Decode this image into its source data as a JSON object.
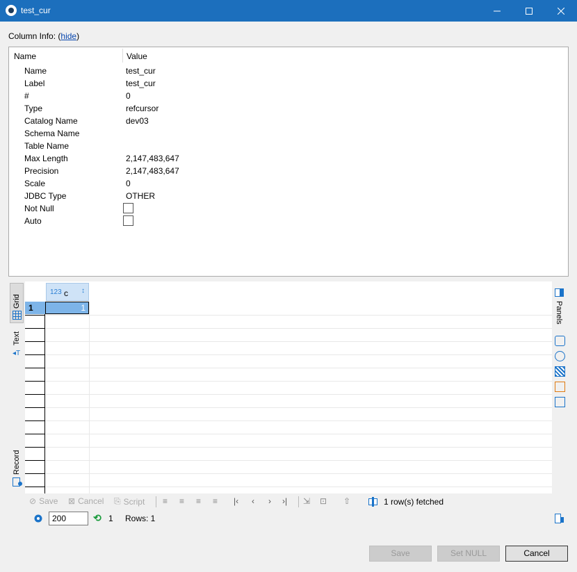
{
  "window": {
    "title": "test_cur",
    "minimize_icon": "minimize-icon",
    "maximize_icon": "maximize-icon",
    "close_icon": "close-icon"
  },
  "column_info": {
    "label": "Column Info:",
    "hide_link": "hide"
  },
  "props_table": {
    "headers": [
      "Name",
      "Value"
    ],
    "rows": [
      {
        "name": "Name",
        "value": "test_cur"
      },
      {
        "name": "Label",
        "value": "test_cur"
      },
      {
        "name": "#",
        "value": "0"
      },
      {
        "name": "Type",
        "value": "refcursor"
      },
      {
        "name": "Catalog Name",
        "value": "dev03"
      },
      {
        "name": "Schema Name",
        "value": ""
      },
      {
        "name": "Table Name",
        "value": ""
      },
      {
        "name": "Max Length",
        "value": "2,147,483,647"
      },
      {
        "name": "Precision",
        "value": "2,147,483,647"
      },
      {
        "name": "Scale",
        "value": "0"
      },
      {
        "name": "JDBC Type",
        "value": "OTHER"
      },
      {
        "name": "Not Null",
        "checked": false
      },
      {
        "name": "Auto",
        "checked": false
      }
    ]
  },
  "side_tabs": {
    "grid": "Grid",
    "text": "Text",
    "record": "Record"
  },
  "grid": {
    "column": {
      "type_badge": "123",
      "name": "c"
    },
    "rows": [
      {
        "num": "1",
        "value": "1"
      }
    ]
  },
  "right_panel": {
    "panels_label": "Panels"
  },
  "toolbar": {
    "save": "Save",
    "cancel": "Cancel",
    "script": "Script",
    "fetched": "1 row(s) fetched"
  },
  "statusbar": {
    "fetch_size": "200",
    "refresh_count": "1",
    "rows": "Rows: 1"
  },
  "footer": {
    "save": "Save",
    "set_null": "Set NULL",
    "cancel": "Cancel"
  }
}
